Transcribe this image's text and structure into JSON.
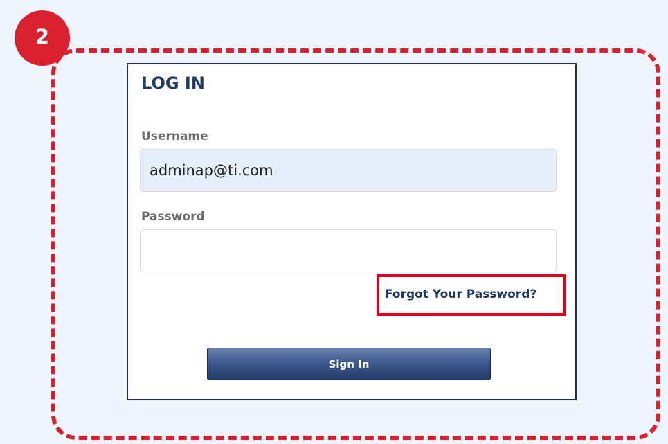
{
  "step_badge": "2",
  "login": {
    "title": "LOG IN",
    "username_label": "Username",
    "username_value": "adminap@ti.com",
    "password_label": "Password",
    "password_value": "",
    "forgot_password_link": "Forgot Your Password?",
    "sign_in_button": "Sign In"
  },
  "colors": {
    "annotation_red": "#d8202e",
    "navy": "#233a63",
    "page_background": "#eef4fb",
    "username_field_background": "#e6eef9"
  }
}
